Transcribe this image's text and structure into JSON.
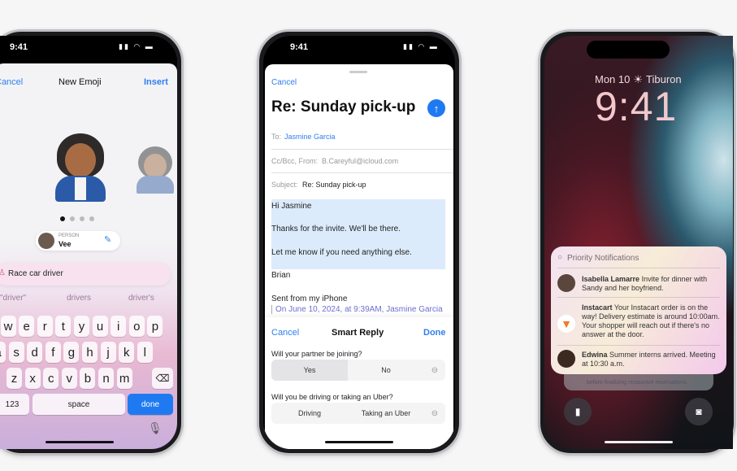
{
  "phone1": {
    "time": "9:41",
    "nav": {
      "cancel": "Cancel",
      "title": "New Emoji",
      "insert": "Insert"
    },
    "page_dots": 4,
    "person_label": "PERSON",
    "person_name": "Vee",
    "prompt": "Race car driver",
    "suggestions": [
      "\"driver\"",
      "drivers",
      "driver's"
    ],
    "keys_row1": [
      "q",
      "w",
      "e",
      "r",
      "t",
      "y",
      "u",
      "i",
      "o",
      "p"
    ],
    "keys_row2": [
      "a",
      "s",
      "d",
      "f",
      "g",
      "h",
      "j",
      "k",
      "l"
    ],
    "keys_row3": [
      "z",
      "x",
      "c",
      "v",
      "b",
      "n",
      "m"
    ],
    "key_123": "123",
    "key_space": "space",
    "key_done": "done"
  },
  "phone2": {
    "time": "9:41",
    "cancel": "Cancel",
    "subject_title": "Re: Sunday pick-up",
    "to_label": "To:",
    "to_value": "Jasmine Garcia",
    "ccbcc_label": "Cc/Bcc, From:",
    "from_value": "B.Careyful@icloud.com",
    "subject_label": "Subject:",
    "subject_value": "Re: Sunday pick-up",
    "body": [
      "Hi Jasmine",
      "Thanks for the invite. We'll be there.",
      "Let me know if you need anything else.",
      "Brian",
      "Sent from my iPhone"
    ],
    "quote": "On June 10, 2024, at 9:39AM, Jasmine Garcia",
    "smart_reply": {
      "cancel": "Cancel",
      "title": "Smart Reply",
      "done": "Done",
      "questions": [
        {
          "q": "Will your partner be joining?",
          "options": [
            "Yes",
            "No"
          ],
          "selected": "Yes"
        },
        {
          "q": "Will you be driving or taking an Uber?",
          "options": [
            "Driving",
            "Taking an Uber"
          ]
        }
      ]
    }
  },
  "phone3": {
    "date_line": "Mon 10",
    "weather_icon": "sun-icon",
    "location": "Tiburon",
    "time": "9:41",
    "priority_title": "Priority Notifications",
    "notifications": [
      {
        "sender": "Isabella Lamarre",
        "text": "Invite for dinner with Sandy and her boyfriend."
      },
      {
        "sender": "Instacart",
        "text": "Your Instacart order is on the way! Delivery estimate is around 10:00am. Your shopper will reach out if there's no answer at the door."
      },
      {
        "sender": "Edwina",
        "text": "Summer interns arrived. Meeting at 10:30 a.m."
      }
    ],
    "stacked_text": "before finalizing restaurant reservations."
  },
  "colors": {
    "accent": "#2f7ef0",
    "background": "#f6f6f7"
  }
}
